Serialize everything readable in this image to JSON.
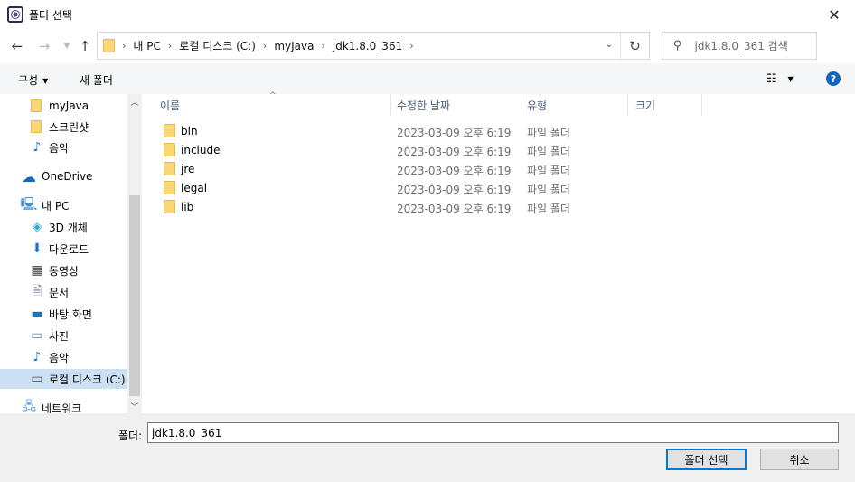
{
  "window": {
    "title": "폴더 선택"
  },
  "address": {
    "crumbs": [
      "내 PC",
      "로컬 디스크 (C:)",
      "myJava",
      "jdk1.8.0_361"
    ]
  },
  "search": {
    "placeholder": "jdk1.8.0_361 검색"
  },
  "toolbar": {
    "organize": "구성",
    "new_folder": "새 폴더"
  },
  "sidebar": {
    "items": [
      {
        "label": "myJava",
        "icon": "folder-icon"
      },
      {
        "label": "스크린샷",
        "icon": "folder-icon"
      },
      {
        "label": "음악",
        "icon": "music-note-icon"
      },
      {
        "label": "OneDrive",
        "icon": "cloud-icon"
      },
      {
        "label": "내 PC",
        "icon": "computer-icon"
      },
      {
        "label": "3D 개체",
        "icon": "cube-3d-icon"
      },
      {
        "label": "다운로드",
        "icon": "download-arrow-icon"
      },
      {
        "label": "동영상",
        "icon": "film-icon"
      },
      {
        "label": "문서",
        "icon": "document-icon"
      },
      {
        "label": "바탕 화면",
        "icon": "desktop-icon"
      },
      {
        "label": "사진",
        "icon": "picture-icon"
      },
      {
        "label": "음악",
        "icon": "music-note-icon"
      },
      {
        "label": "로컬 디스크 (C:)",
        "icon": "drive-icon"
      },
      {
        "label": "네트워크",
        "icon": "network-icon"
      }
    ],
    "selected": "로컬 디스크 (C:)"
  },
  "columns": [
    "이름",
    "수정한 날짜",
    "유형",
    "크기"
  ],
  "files": [
    {
      "name": "bin",
      "modified": "2023-03-09 오후 6:19",
      "type": "파일 폴더"
    },
    {
      "name": "include",
      "modified": "2023-03-09 오후 6:19",
      "type": "파일 폴더"
    },
    {
      "name": "jre",
      "modified": "2023-03-09 오후 6:19",
      "type": "파일 폴더"
    },
    {
      "name": "legal",
      "modified": "2023-03-09 오후 6:19",
      "type": "파일 폴더"
    },
    {
      "name": "lib",
      "modified": "2023-03-09 오후 6:19",
      "type": "파일 폴더"
    }
  ],
  "footer": {
    "folder_label": "폴더:",
    "folder_value": "jdk1.8.0_361",
    "select_button": "폴더 선택",
    "cancel_button": "취소"
  },
  "colors": {
    "accent": "#0078d7",
    "help": "#1565c0",
    "folder": "#f8d775",
    "selected_bg": "#cce0f4"
  }
}
